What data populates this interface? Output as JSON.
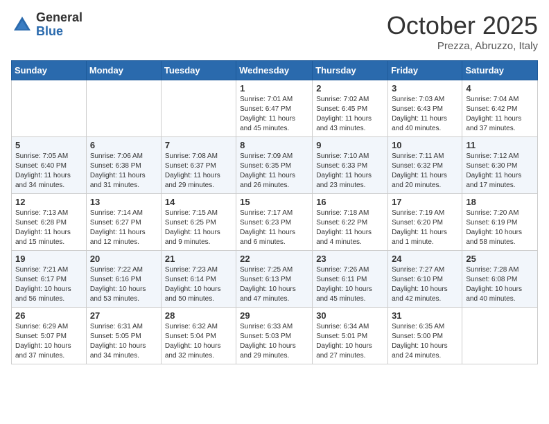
{
  "header": {
    "logo_general": "General",
    "logo_blue": "Blue",
    "month": "October 2025",
    "location": "Prezza, Abruzzo, Italy"
  },
  "weekdays": [
    "Sunday",
    "Monday",
    "Tuesday",
    "Wednesday",
    "Thursday",
    "Friday",
    "Saturday"
  ],
  "weeks": [
    [
      {
        "day": "",
        "info": ""
      },
      {
        "day": "",
        "info": ""
      },
      {
        "day": "",
        "info": ""
      },
      {
        "day": "1",
        "info": "Sunrise: 7:01 AM\nSunset: 6:47 PM\nDaylight: 11 hours\nand 45 minutes."
      },
      {
        "day": "2",
        "info": "Sunrise: 7:02 AM\nSunset: 6:45 PM\nDaylight: 11 hours\nand 43 minutes."
      },
      {
        "day": "3",
        "info": "Sunrise: 7:03 AM\nSunset: 6:43 PM\nDaylight: 11 hours\nand 40 minutes."
      },
      {
        "day": "4",
        "info": "Sunrise: 7:04 AM\nSunset: 6:42 PM\nDaylight: 11 hours\nand 37 minutes."
      }
    ],
    [
      {
        "day": "5",
        "info": "Sunrise: 7:05 AM\nSunset: 6:40 PM\nDaylight: 11 hours\nand 34 minutes."
      },
      {
        "day": "6",
        "info": "Sunrise: 7:06 AM\nSunset: 6:38 PM\nDaylight: 11 hours\nand 31 minutes."
      },
      {
        "day": "7",
        "info": "Sunrise: 7:08 AM\nSunset: 6:37 PM\nDaylight: 11 hours\nand 29 minutes."
      },
      {
        "day": "8",
        "info": "Sunrise: 7:09 AM\nSunset: 6:35 PM\nDaylight: 11 hours\nand 26 minutes."
      },
      {
        "day": "9",
        "info": "Sunrise: 7:10 AM\nSunset: 6:33 PM\nDaylight: 11 hours\nand 23 minutes."
      },
      {
        "day": "10",
        "info": "Sunrise: 7:11 AM\nSunset: 6:32 PM\nDaylight: 11 hours\nand 20 minutes."
      },
      {
        "day": "11",
        "info": "Sunrise: 7:12 AM\nSunset: 6:30 PM\nDaylight: 11 hours\nand 17 minutes."
      }
    ],
    [
      {
        "day": "12",
        "info": "Sunrise: 7:13 AM\nSunset: 6:28 PM\nDaylight: 11 hours\nand 15 minutes."
      },
      {
        "day": "13",
        "info": "Sunrise: 7:14 AM\nSunset: 6:27 PM\nDaylight: 11 hours\nand 12 minutes."
      },
      {
        "day": "14",
        "info": "Sunrise: 7:15 AM\nSunset: 6:25 PM\nDaylight: 11 hours\nand 9 minutes."
      },
      {
        "day": "15",
        "info": "Sunrise: 7:17 AM\nSunset: 6:23 PM\nDaylight: 11 hours\nand 6 minutes."
      },
      {
        "day": "16",
        "info": "Sunrise: 7:18 AM\nSunset: 6:22 PM\nDaylight: 11 hours\nand 4 minutes."
      },
      {
        "day": "17",
        "info": "Sunrise: 7:19 AM\nSunset: 6:20 PM\nDaylight: 11 hours\nand 1 minute."
      },
      {
        "day": "18",
        "info": "Sunrise: 7:20 AM\nSunset: 6:19 PM\nDaylight: 10 hours\nand 58 minutes."
      }
    ],
    [
      {
        "day": "19",
        "info": "Sunrise: 7:21 AM\nSunset: 6:17 PM\nDaylight: 10 hours\nand 56 minutes."
      },
      {
        "day": "20",
        "info": "Sunrise: 7:22 AM\nSunset: 6:16 PM\nDaylight: 10 hours\nand 53 minutes."
      },
      {
        "day": "21",
        "info": "Sunrise: 7:23 AM\nSunset: 6:14 PM\nDaylight: 10 hours\nand 50 minutes."
      },
      {
        "day": "22",
        "info": "Sunrise: 7:25 AM\nSunset: 6:13 PM\nDaylight: 10 hours\nand 47 minutes."
      },
      {
        "day": "23",
        "info": "Sunrise: 7:26 AM\nSunset: 6:11 PM\nDaylight: 10 hours\nand 45 minutes."
      },
      {
        "day": "24",
        "info": "Sunrise: 7:27 AM\nSunset: 6:10 PM\nDaylight: 10 hours\nand 42 minutes."
      },
      {
        "day": "25",
        "info": "Sunrise: 7:28 AM\nSunset: 6:08 PM\nDaylight: 10 hours\nand 40 minutes."
      }
    ],
    [
      {
        "day": "26",
        "info": "Sunrise: 6:29 AM\nSunset: 5:07 PM\nDaylight: 10 hours\nand 37 minutes."
      },
      {
        "day": "27",
        "info": "Sunrise: 6:31 AM\nSunset: 5:05 PM\nDaylight: 10 hours\nand 34 minutes."
      },
      {
        "day": "28",
        "info": "Sunrise: 6:32 AM\nSunset: 5:04 PM\nDaylight: 10 hours\nand 32 minutes."
      },
      {
        "day": "29",
        "info": "Sunrise: 6:33 AM\nSunset: 5:03 PM\nDaylight: 10 hours\nand 29 minutes."
      },
      {
        "day": "30",
        "info": "Sunrise: 6:34 AM\nSunset: 5:01 PM\nDaylight: 10 hours\nand 27 minutes."
      },
      {
        "day": "31",
        "info": "Sunrise: 6:35 AM\nSunset: 5:00 PM\nDaylight: 10 hours\nand 24 minutes."
      },
      {
        "day": "",
        "info": ""
      }
    ]
  ]
}
